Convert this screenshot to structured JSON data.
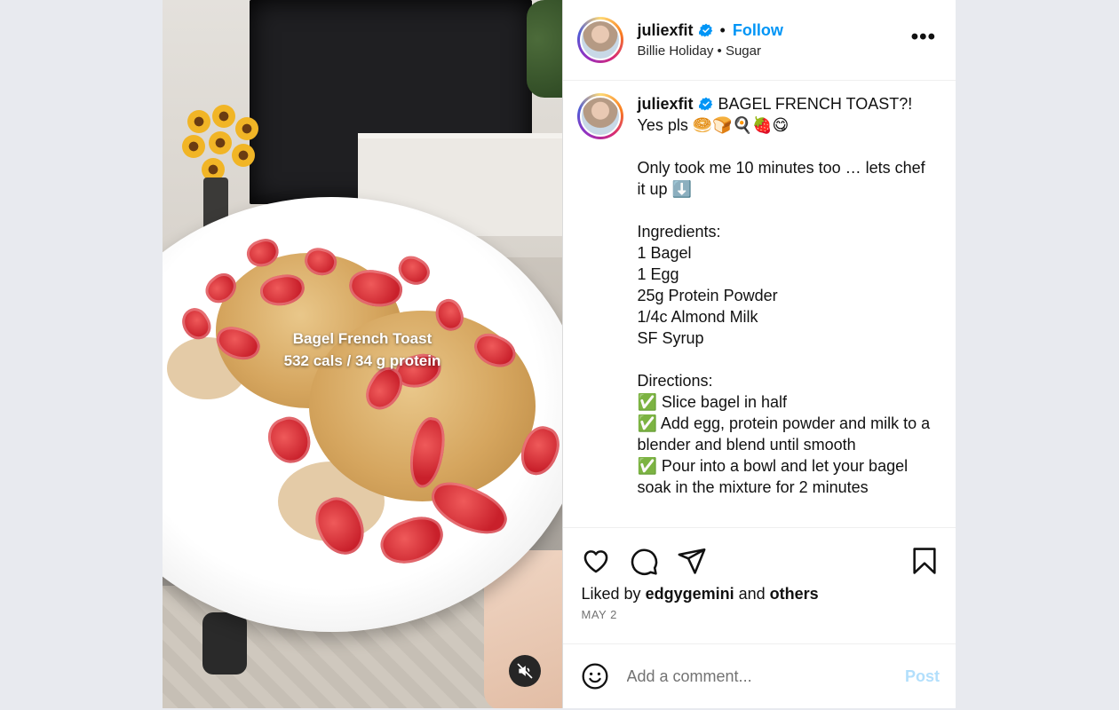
{
  "post": {
    "username": "juliexfit",
    "follow_label": "Follow",
    "separator": "•",
    "music": "Billie Holiday • Sugar",
    "more_label": "•••"
  },
  "media": {
    "overlay_title": "Bagel French Toast",
    "overlay_subtitle": "532 cals / 34 g protein"
  },
  "caption": {
    "username": "juliexfit",
    "text": "BAGEL FRENCH TOAST?!\nYes pls 🥯🍞🍳🍓😋\n\nOnly took me 10 minutes too … lets chef it up ⬇️\n\nIngredients:\n1 Bagel\n1 Egg\n25g Protein Powder\n1/4c Almond Milk\nSF Syrup\n\nDirections:\n✅ Slice bagel in half\n✅ Add egg, protein powder and milk to a blender and blend until smooth\n✅ Pour into a bowl and let your bagel soak in the mixture for 2 minutes"
  },
  "likes": {
    "prefix": "Liked by",
    "user": "edgygemini",
    "conjunction": "and",
    "others": "others"
  },
  "date": "MAY 2",
  "comment": {
    "placeholder": "Add a comment...",
    "post_label": "Post"
  },
  "colors": {
    "accent": "#0095f6",
    "post_disabled": "#b2dffc",
    "verified": "#0095f6"
  }
}
